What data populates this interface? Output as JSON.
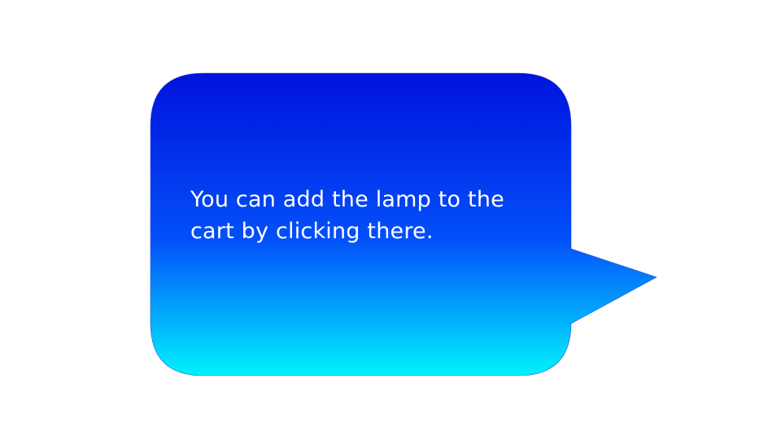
{
  "tooltip": {
    "message": "You can add the lamp to the cart by clicking there."
  },
  "colors": {
    "gradient_top": "#0012DC",
    "gradient_mid": "#0350FA",
    "gradient_bottom": "#00F2FC",
    "text": "#FFFFFF",
    "background": "#FFFFFF"
  }
}
